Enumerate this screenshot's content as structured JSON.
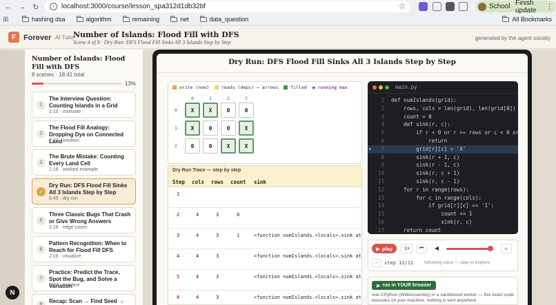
{
  "browser": {
    "url": "localhost:3000/course/lesson_spa312d1db32bf",
    "profile": "School",
    "finish_update": "Finish update",
    "bookmarks": [
      "hashing dsa",
      "algorithm",
      "remaining",
      "net",
      "data_question"
    ],
    "all_bookmarks": "All Bookmarks"
  },
  "header": {
    "logo_letter": "F",
    "brand": "Forever",
    "brand_sub": "AI Tutor",
    "title": "Number of Islands: Flood Fill with DFS",
    "subtitle": "Scene 4 of 8 · Dry Run: DFS Flood Fill Sinks All 3 Islands Step by Step",
    "generated_by": "generated by the agent society"
  },
  "sidebar": {
    "title": "Number of Islands: Flood Fill with DFS",
    "meta": "8 scenes · 18:41 total",
    "progress_pct": 13,
    "progress_label": "13%",
    "scenes": [
      {
        "num": "1",
        "title": "The Interview Question: Counting Islands in a Grid",
        "meta": "1:10 · motivate"
      },
      {
        "num": "2",
        "title": "The Flood Fill Analogy: Dropping Dye on Connected Land",
        "meta": "2:27 · intuition"
      },
      {
        "num": "3",
        "title": "The Brute Mistake: Counting Every Land Cell",
        "meta": "1:16 · worked example"
      },
      {
        "num": "✓",
        "title": "Dry Run: DFS Flood Fill Sinks All 3 Islands Step by Step",
        "meta": "5:45 · dry run"
      },
      {
        "num": "5",
        "title": "Three Classic Bugs That Crash or Give Wrong Answers",
        "meta": "2:16 · edge cases"
      },
      {
        "num": "6",
        "title": "Pattern Recognition: When to Reach for Flood Fill DFS",
        "meta": "2:16 · visualize"
      },
      {
        "num": "7",
        "title": "Practice: Predict the Trace, Spot the Bug, and Solve a Variation",
        "meta": "2:02 · practice"
      },
      {
        "num": "8",
        "title": "Recap: Scan → Find Seed → Sink →",
        "meta": ""
      }
    ],
    "corner_badge": "N"
  },
  "main": {
    "title": "Dry Run: DFS Flood Fill Sinks All 3 Islands Step by Step",
    "legend": {
      "write": "write (now)",
      "reads": "reads (deps) → arrows",
      "filled": "filled",
      "running": "running max"
    },
    "colors": {
      "write": "#f0a040",
      "reads": "#f2d16b",
      "filled": "#3c8f4a",
      "running": "#8e44ad"
    },
    "grid": {
      "col_labels": [
        "0",
        "1",
        "2",
        "3"
      ],
      "row_labels": [
        "0",
        "1",
        "2"
      ],
      "rows": [
        [
          {
            "v": "X",
            "f": true
          },
          {
            "v": "X",
            "f": true
          },
          {
            "v": "0",
            "f": false
          },
          {
            "v": "0",
            "f": false
          }
        ],
        [
          {
            "v": "X",
            "f": true
          },
          {
            "v": "0",
            "f": false
          },
          {
            "v": "0",
            "f": false
          },
          {
            "v": "X",
            "f": true
          }
        ],
        [
          {
            "v": "0",
            "f": false
          },
          {
            "v": "0",
            "f": false
          },
          {
            "v": "X",
            "f": true
          },
          {
            "v": "X",
            "f": true
          }
        ]
      ]
    },
    "trace": {
      "heading": "Dry Run Trace — step by step",
      "columns": [
        "Step",
        "cols",
        "rows",
        "count",
        "sink"
      ],
      "rows": [
        {
          "step": "1",
          "cols": "",
          "rows": "",
          "count": "",
          "sink": ""
        },
        {
          "step": "2",
          "cols": "4",
          "rows": "3",
          "count": "0",
          "sink": ""
        },
        {
          "step": "3",
          "cols": "4",
          "rows": "3",
          "count": "1",
          "sink": "<function numIslands.<locals>.sink at"
        },
        {
          "step": "4",
          "cols": "4",
          "rows": "3",
          "count": "",
          "sink": "<function numIslands.<locals>.sink at"
        },
        {
          "step": "5",
          "cols": "4",
          "rows": "3",
          "count": "",
          "sink": "<function numIslands.<locals>.sink at"
        },
        {
          "step": "6",
          "cols": "4",
          "rows": "3",
          "count": "",
          "sink": "<function numIslands.<locals>.sink at"
        }
      ]
    },
    "code": {
      "filename": "main.py",
      "highlight_line": 7,
      "lines": [
        "def numIslands(grid):",
        "    rows, cols = len(grid), len(grid[0])",
        "    count = 0",
        "    def sink(r, c):",
        "        if r < 0 or r >= rows or c < 0 or c",
        "            return",
        "        grid[r][c] = 'X'",
        "        sink(r + 1, c)",
        "        sink(r - 1, c)",
        "        sink(r, c + 1)",
        "        sink(r, c - 1)",
        "    for r in range(rows):",
        "        for c in range(cols):",
        "            if grid[r][c] == '1':",
        "                count += 1",
        "                sink(r, c)",
        "    return count"
      ]
    },
    "controls": {
      "play": "play",
      "speed": "1×",
      "step_label": "step 11/11",
      "step_hint": "following voice — step to explore",
      "volume_level": 0.97
    },
    "run": {
      "button": "run in YOUR browser",
      "description": "real CPython (WebAssembly) in a sandboxed worker — this exact code executes on your machine, nothing is sent anywhere"
    }
  }
}
